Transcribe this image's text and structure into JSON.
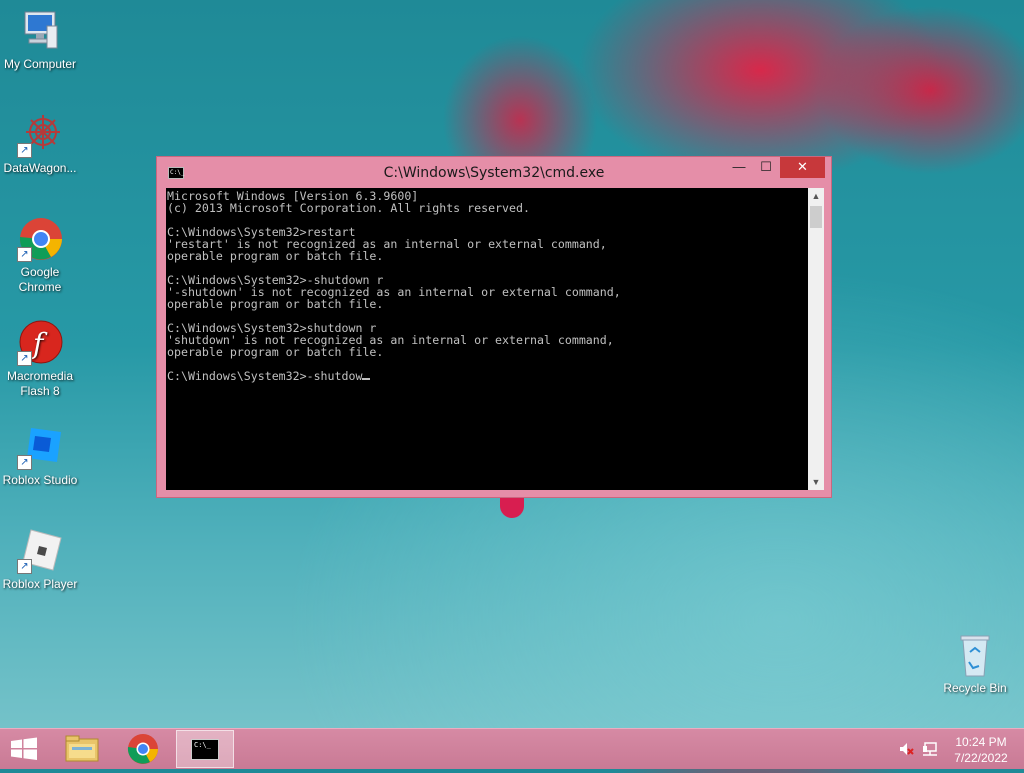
{
  "desktop": {
    "icons": [
      {
        "label": "My Computer"
      },
      {
        "label": "DataWagon..."
      },
      {
        "label": "Google Chrome"
      },
      {
        "label": "Macromedia Flash 8"
      },
      {
        "label": "Roblox Studio"
      },
      {
        "label": "Roblox Player"
      },
      {
        "label": "Recycle Bin"
      }
    ]
  },
  "cmd": {
    "title": "C:\\Windows\\System32\\cmd.exe",
    "sys_icon_text": "C:\\_",
    "minimize_glyph": "—",
    "maximize_glyph": "☐",
    "close_glyph": "✕",
    "lines": "Microsoft Windows [Version 6.3.9600]\n(c) 2013 Microsoft Corporation. All rights reserved.\n\nC:\\Windows\\System32>restart\n'restart' is not recognized as an internal or external command,\noperable program or batch file.\n\nC:\\Windows\\System32>-shutdown r\n'-shutdown' is not recognized as an internal or external command,\noperable program or batch file.\n\nC:\\Windows\\System32>shutdown r\n'shutdown' is not recognized as an internal or external command,\noperable program or batch file.\n\nC:\\Windows\\System32>-shutdow"
  },
  "taskbar": {
    "cmd_icon_text": "C:\\_",
    "clock_time": "10:24 PM",
    "clock_date": "7/22/2022"
  },
  "colors": {
    "window_frame": "#e58ea8",
    "close_button": "#c7383b",
    "taskbar": "#d68aa4"
  }
}
